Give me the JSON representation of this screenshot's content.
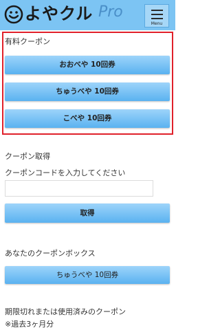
{
  "header": {
    "logo_text": "よやクル",
    "logo_suffix": "Pro",
    "menu_label": "Menu",
    "colors": {
      "bar": "#7cc4f3",
      "accent": "#4a8fc8"
    }
  },
  "paid_coupons": {
    "title": "有料クーポン",
    "buttons": [
      "おおべや 10回券",
      "ちゅうべや 10回券",
      "こべや 10回券"
    ]
  },
  "acquire": {
    "title": "クーポン取得",
    "prompt": "クーポンコードを入力してください",
    "input_value": "",
    "submit_label": "取得"
  },
  "coupon_box": {
    "title": "あなたのクーポンボックス",
    "items": [
      "ちゅうべや 10回券"
    ]
  },
  "expired": {
    "title": "期限切れまたは使用済みのクーポン",
    "note": "※過去3ヶ月分"
  }
}
